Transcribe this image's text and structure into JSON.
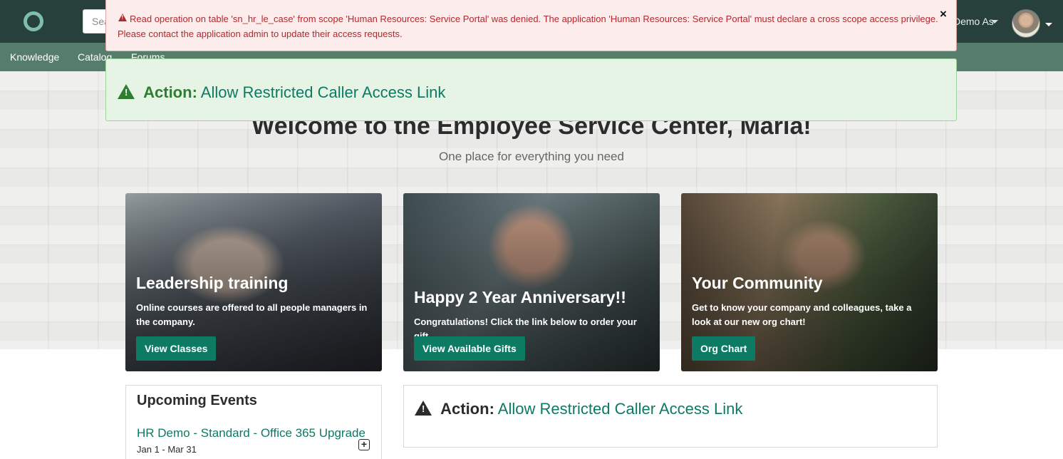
{
  "header": {
    "search_placeholder": "Search",
    "impersonate_label": "Demo As",
    "avatar_alt": "user-avatar"
  },
  "nav": {
    "items": [
      "Knowledge",
      "Catalog",
      "Forums"
    ]
  },
  "alerts": {
    "error_text": "Read operation on table 'sn_hr_le_case' from scope 'Human Resources: Service Portal' was denied. The application 'Human Resources: Service Portal' must declare a cross scope access privilege. Please contact the application admin to update their access requests.",
    "close_symbol": "×",
    "action_prefix": "Action:",
    "action_link": "Allow Restricted Caller Access Link"
  },
  "hero": {
    "welcome": "Welcome to the Employee Service Center, Maria!",
    "tagline": "One place for everything you need"
  },
  "cards": [
    {
      "title": "Leadership training",
      "text": "Online courses are offered to all people managers in the company.",
      "button": "View Classes"
    },
    {
      "title": "Happy 2 Year Anniversary!!",
      "text": "Congratulations! Click the link below to order your gift.",
      "button": "View Available Gifts"
    },
    {
      "title": "Your Community",
      "text": "Get to know your company and colleagues, take a look at our new org chart!",
      "button": "Org Chart"
    }
  ],
  "events": {
    "title": "Upcoming Events",
    "items": [
      {
        "name": "HR Demo - Standard - Office 365 Upgrade",
        "date": "Jan 1 - Mar 31"
      }
    ]
  },
  "action_panel": {
    "prefix": "Action:",
    "link": "Allow Restricted Caller Access Link"
  },
  "colors": {
    "header_bg": "#27403b",
    "nav_bg": "#567d6c",
    "brand_green": "#0d7a64",
    "error_red": "#b3282d",
    "success_green": "#2e7d32"
  }
}
